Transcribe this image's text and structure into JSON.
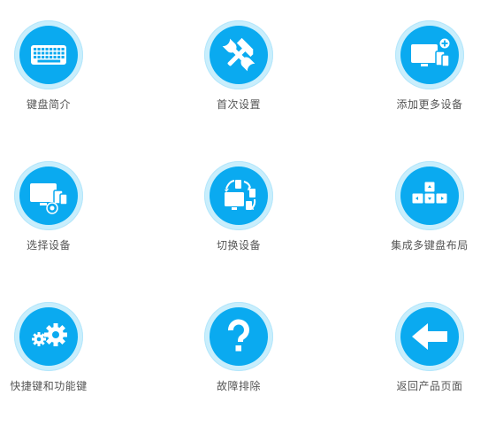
{
  "accent_color": "#0aaaf0",
  "ring_color": "#c9eefc",
  "tiles": [
    {
      "label": "键盘简介",
      "icon": "keyboard-icon"
    },
    {
      "label": "首次设置",
      "icon": "tools-icon"
    },
    {
      "label": "添加更多设备",
      "icon": "add-devices-icon"
    },
    {
      "label": "选择设备",
      "icon": "select-device-icon"
    },
    {
      "label": "切换设备",
      "icon": "switch-device-icon"
    },
    {
      "label": "集成多键盘布局",
      "icon": "arrow-keys-icon"
    },
    {
      "label": "快捷键和功能键",
      "icon": "gears-icon"
    },
    {
      "label": "故障排除",
      "icon": "question-mark-icon"
    },
    {
      "label": "返回产品页面",
      "icon": "back-arrow-icon"
    }
  ]
}
